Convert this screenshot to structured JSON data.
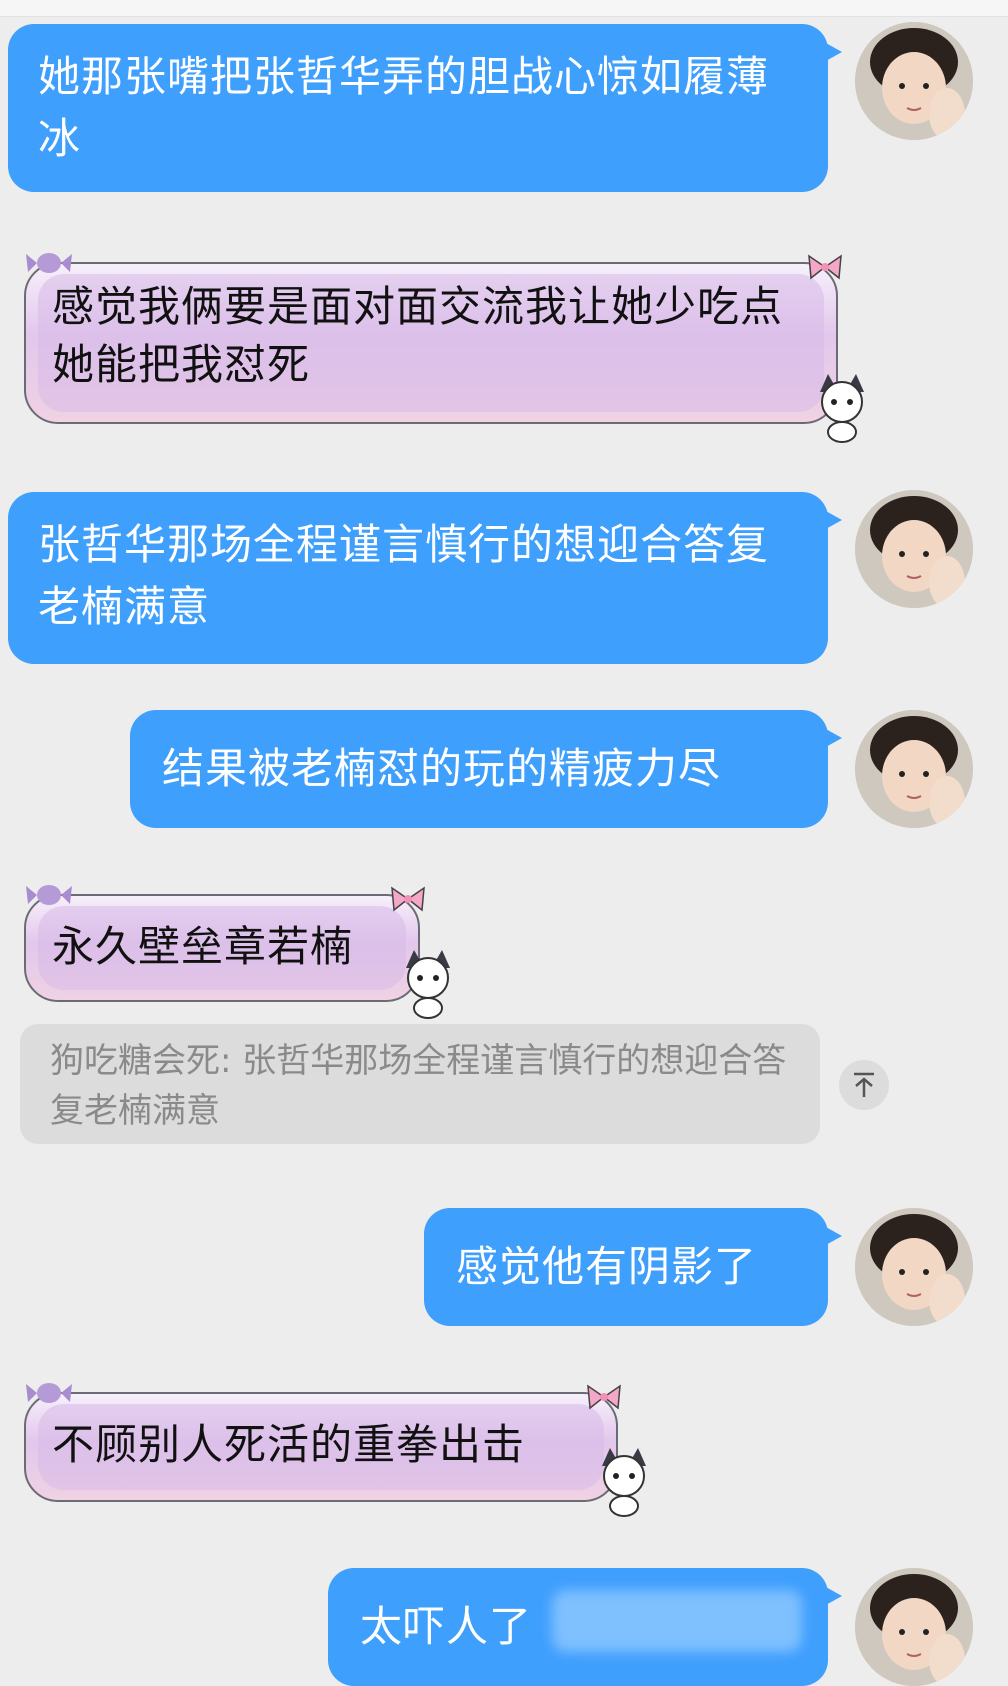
{
  "messages": [
    {
      "side": "right",
      "style": "blue",
      "text": "她那张嘴把张哲华弄的胆战心惊如履薄冰"
    },
    {
      "side": "left",
      "style": "pink",
      "text": "感觉我俩要是面对面交流我让她少吃点她能把我怼死"
    },
    {
      "side": "right",
      "style": "blue",
      "text": "张哲华那场全程谨言慎行的想迎合答复老楠满意"
    },
    {
      "side": "right",
      "style": "blue",
      "text": "结果被老楠怼的玩的精疲力尽"
    },
    {
      "side": "left",
      "style": "pink",
      "text": "永久壁垒章若楠"
    },
    {
      "side": "left",
      "style": "quote",
      "text": "狗吃糖会死: 张哲华那场全程谨言慎行的想迎合答复老楠满意"
    },
    {
      "side": "right",
      "style": "blue",
      "text": "感觉他有阴影了"
    },
    {
      "side": "left",
      "style": "pink",
      "text": "不顾别人死活的重拳出击"
    },
    {
      "side": "right",
      "style": "blue",
      "text": "太吓人了"
    }
  ],
  "colors": {
    "blue_bubble": "#3f9ffd",
    "background": "#ededed",
    "quote_bg": "#dcdcdc"
  },
  "icons": {
    "quote_scroll": "arrow-up-to-line-icon",
    "avatar": "user-avatar-photo",
    "bubble_deco": "candy-bow-kuromi-sticker"
  }
}
